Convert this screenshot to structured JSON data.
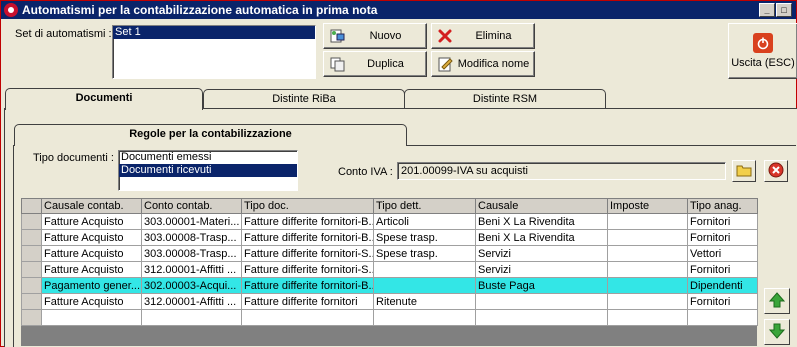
{
  "window": {
    "title": "Automatismi per la contabilizzazione automatica in prima nota",
    "min_glyph": "_",
    "max_glyph": "□"
  },
  "set": {
    "label": "Set di automatismi :",
    "items": [
      "Set 1"
    ]
  },
  "buttons": {
    "nuovo": "Nuovo",
    "elimina": "Elimina",
    "duplica": "Duplica",
    "modifica_nome": "Modifica nome",
    "uscita": "Uscita (ESC)"
  },
  "tabs": [
    "Documenti",
    "Distinte RiBa",
    "Distinte RSM"
  ],
  "subtab": "Regole per la contabilizzazione",
  "tipo_documenti": {
    "label": "Tipo documenti :",
    "items": [
      "Documenti emessi",
      "Documenti ricevuti"
    ],
    "selected_index": 1
  },
  "conto_iva": {
    "label": "Conto IVA :",
    "value": "201.00099-IVA su acquisti"
  },
  "grid": {
    "columns": [
      "Causale contab.",
      "Conto contab.",
      "Tipo doc.",
      "Tipo dett.",
      "Causale",
      "Imposte",
      "Tipo anag."
    ],
    "rows": [
      [
        "Fatture Acquisto",
        "303.00001-Materi...",
        "Fatture differite fornitori-B...",
        "Articoli",
        "Beni X La Rivendita",
        "",
        "Fornitori"
      ],
      [
        "Fatture Acquisto",
        "303.00008-Trasp...",
        "Fatture differite fornitori-B...",
        "Spese trasp.",
        "Beni X La Rivendita",
        "",
        "Fornitori"
      ],
      [
        "Fatture Acquisto",
        "303.00008-Trasp...",
        "Fatture differite fornitori-S...",
        "Spese trasp.",
        "Servizi",
        "",
        "Vettori"
      ],
      [
        "Fatture Acquisto",
        "312.00001-Affitti ...",
        "Fatture differite fornitori-S...",
        "",
        "Servizi",
        "",
        "Fornitori"
      ],
      [
        "Pagamento gener...",
        "302.00003-Acqui...",
        "Fatture differite fornitori-B...",
        "",
        "Buste Paga",
        "",
        "Dipendenti"
      ],
      [
        "Fatture Acquisto",
        "312.00001-Affitti ...",
        "Fatture differite fornitori",
        "Ritenute",
        "",
        "",
        "Fornitori"
      ],
      [
        "",
        "",
        "",
        "",
        "",
        "",
        ""
      ]
    ],
    "highlight_row": 4
  },
  "colors": {
    "titlebar": "#0a246a",
    "highlight": "#33e6e6",
    "selection": "#0a246a",
    "exit": "#d9411e",
    "arrow": "#3aa53a"
  },
  "icons": {
    "nuovo": "new-doc-icon",
    "elimina": "red-x-icon",
    "duplica": "copy-doc-icon",
    "modifica_nome": "edit-note-icon",
    "uscita": "power-icon",
    "folder": "folder-icon",
    "clear": "clear-circle-icon",
    "up": "arrow-up-icon",
    "down": "arrow-down-icon"
  }
}
